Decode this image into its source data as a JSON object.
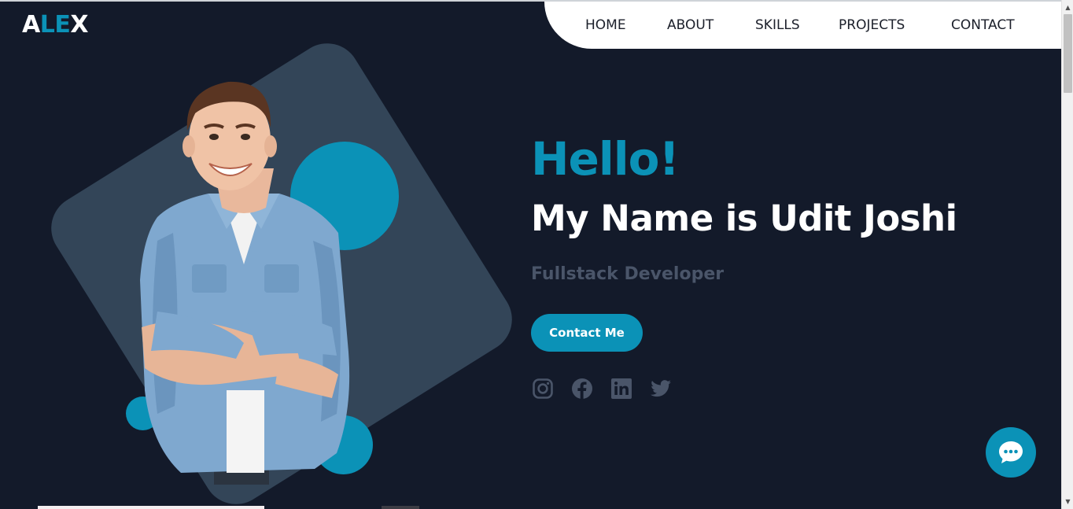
{
  "brand": {
    "logo_part1": "A",
    "logo_part2": "LE",
    "logo_part3": "X",
    "accent": "#0b92b7"
  },
  "nav": {
    "items": [
      {
        "label": "HOME"
      },
      {
        "label": "ABOUT"
      },
      {
        "label": "SKILLS"
      },
      {
        "label": "PROJECTS"
      },
      {
        "label": "CONTACT"
      }
    ]
  },
  "hero": {
    "greeting": "Hello!",
    "name_line": "My Name is Udit Joshi",
    "role": "Fullstack Developer",
    "cta_label": "Contact Me",
    "socials": [
      {
        "icon": "instagram-icon"
      },
      {
        "icon": "facebook-icon"
      },
      {
        "icon": "linkedin-icon"
      },
      {
        "icon": "twitter-icon"
      }
    ]
  },
  "chat": {
    "icon": "chat-icon"
  },
  "colors": {
    "background": "#131a2a",
    "panel": "#334558",
    "accent": "#0b92b7",
    "muted_text": "#4a5569"
  }
}
